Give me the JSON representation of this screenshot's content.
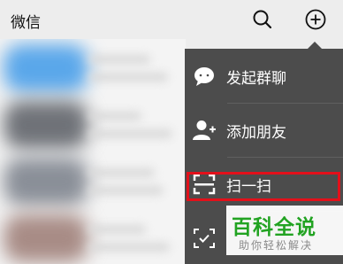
{
  "header": {
    "title": "微信",
    "search_icon": "search-icon",
    "add_icon": "plus-circle-icon"
  },
  "menu": {
    "items": [
      {
        "label": "发起群聊",
        "icon": "chat-bubble-icon"
      },
      {
        "label": "添加朋友",
        "icon": "add-friend-icon"
      },
      {
        "label": "扫一扫",
        "icon": "scan-icon"
      },
      {
        "label": "",
        "icon": "receipt-icon"
      }
    ],
    "highlight_color": "#e3101a",
    "background_color": "#4c4c4c"
  },
  "watermark": {
    "title": "百科全说",
    "subtitle": "助你轻松解决"
  }
}
